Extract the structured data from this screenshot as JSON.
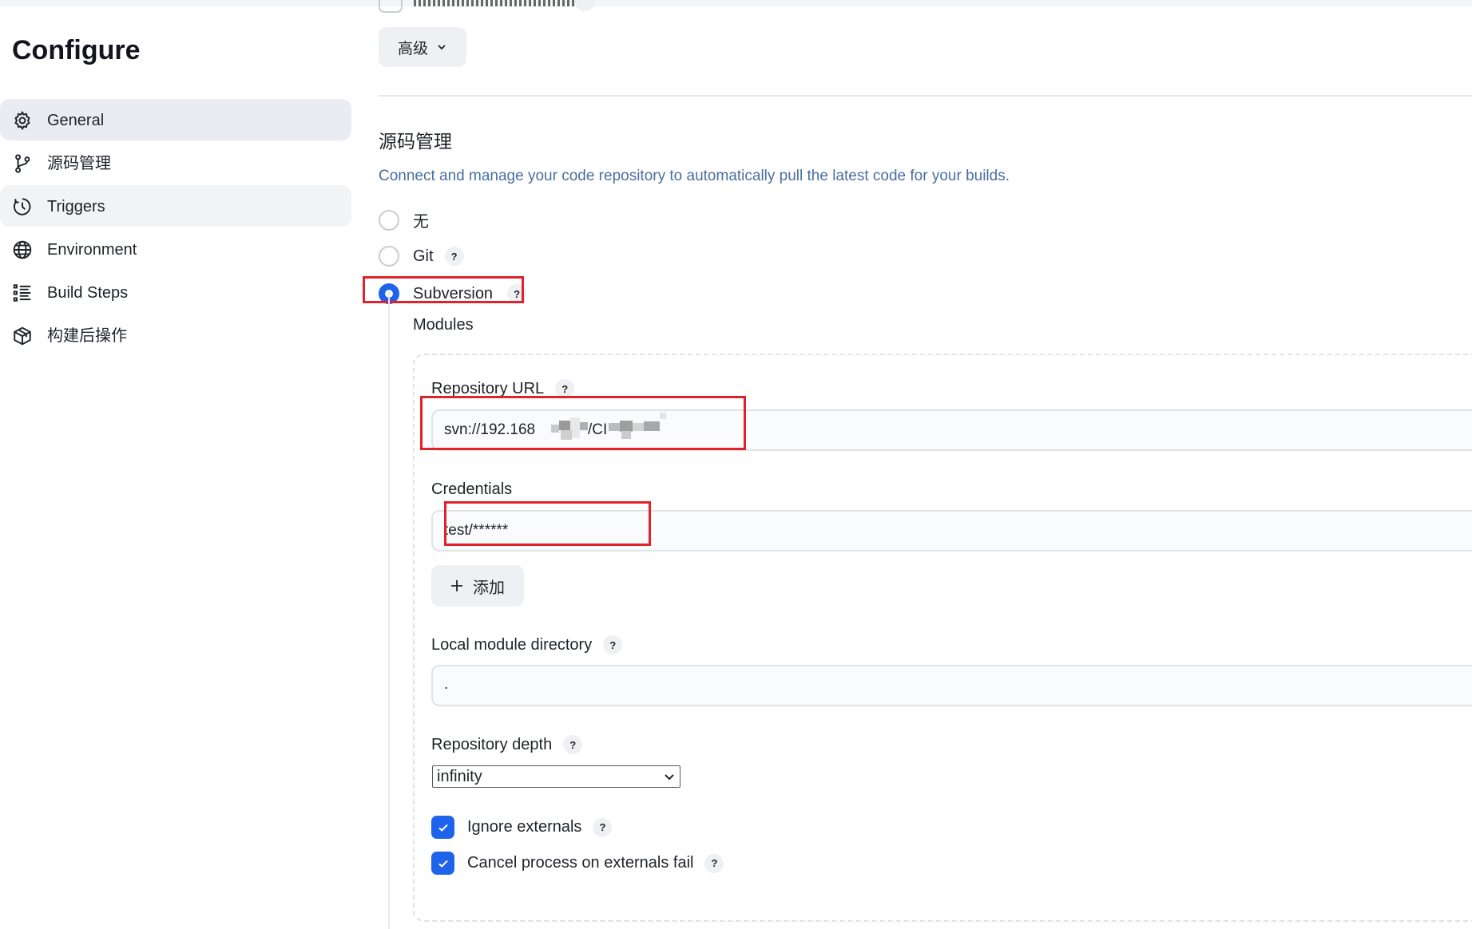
{
  "page": {
    "title": "Configure"
  },
  "sidebar": {
    "items": [
      {
        "label": "General",
        "icon": "gear-icon"
      },
      {
        "label": "源码管理",
        "icon": "branch-icon"
      },
      {
        "label": "Triggers",
        "icon": "clock-icon"
      },
      {
        "label": "Environment",
        "icon": "globe-icon"
      },
      {
        "label": "Build Steps",
        "icon": "list-icon"
      },
      {
        "label": "构建后操作",
        "icon": "package-icon"
      }
    ]
  },
  "main": {
    "advanced_button": "高级",
    "scm": {
      "title": "源码管理",
      "description": "Connect and manage your code repository to automatically pull the latest code for your builds.",
      "options": [
        {
          "label": "无",
          "checked": false
        },
        {
          "label": "Git",
          "checked": false,
          "help": "?"
        },
        {
          "label": "Subversion",
          "checked": true,
          "help": "?"
        }
      ],
      "modules_label": "Modules",
      "repository_url": {
        "label": "Repository URL",
        "value_prefix": "svn://192.168",
        "value_mid": "/CI",
        "help": "?"
      },
      "credentials": {
        "label": "Credentials",
        "value": "test/******"
      },
      "add_button": "添加",
      "local_module_directory": {
        "label": "Local module directory",
        "value": ".",
        "help": "?"
      },
      "repository_depth": {
        "label": "Repository depth",
        "value": "infinity",
        "help": "?"
      },
      "ignore_externals": {
        "label": "Ignore externals",
        "checked": true,
        "help": "?"
      },
      "cancel_process": {
        "label": "Cancel process on externals fail",
        "checked": true,
        "help": "?"
      }
    }
  },
  "colors": {
    "accent": "#1e63e9",
    "highlight": "#e0222b",
    "description": "#4a6ea0"
  }
}
